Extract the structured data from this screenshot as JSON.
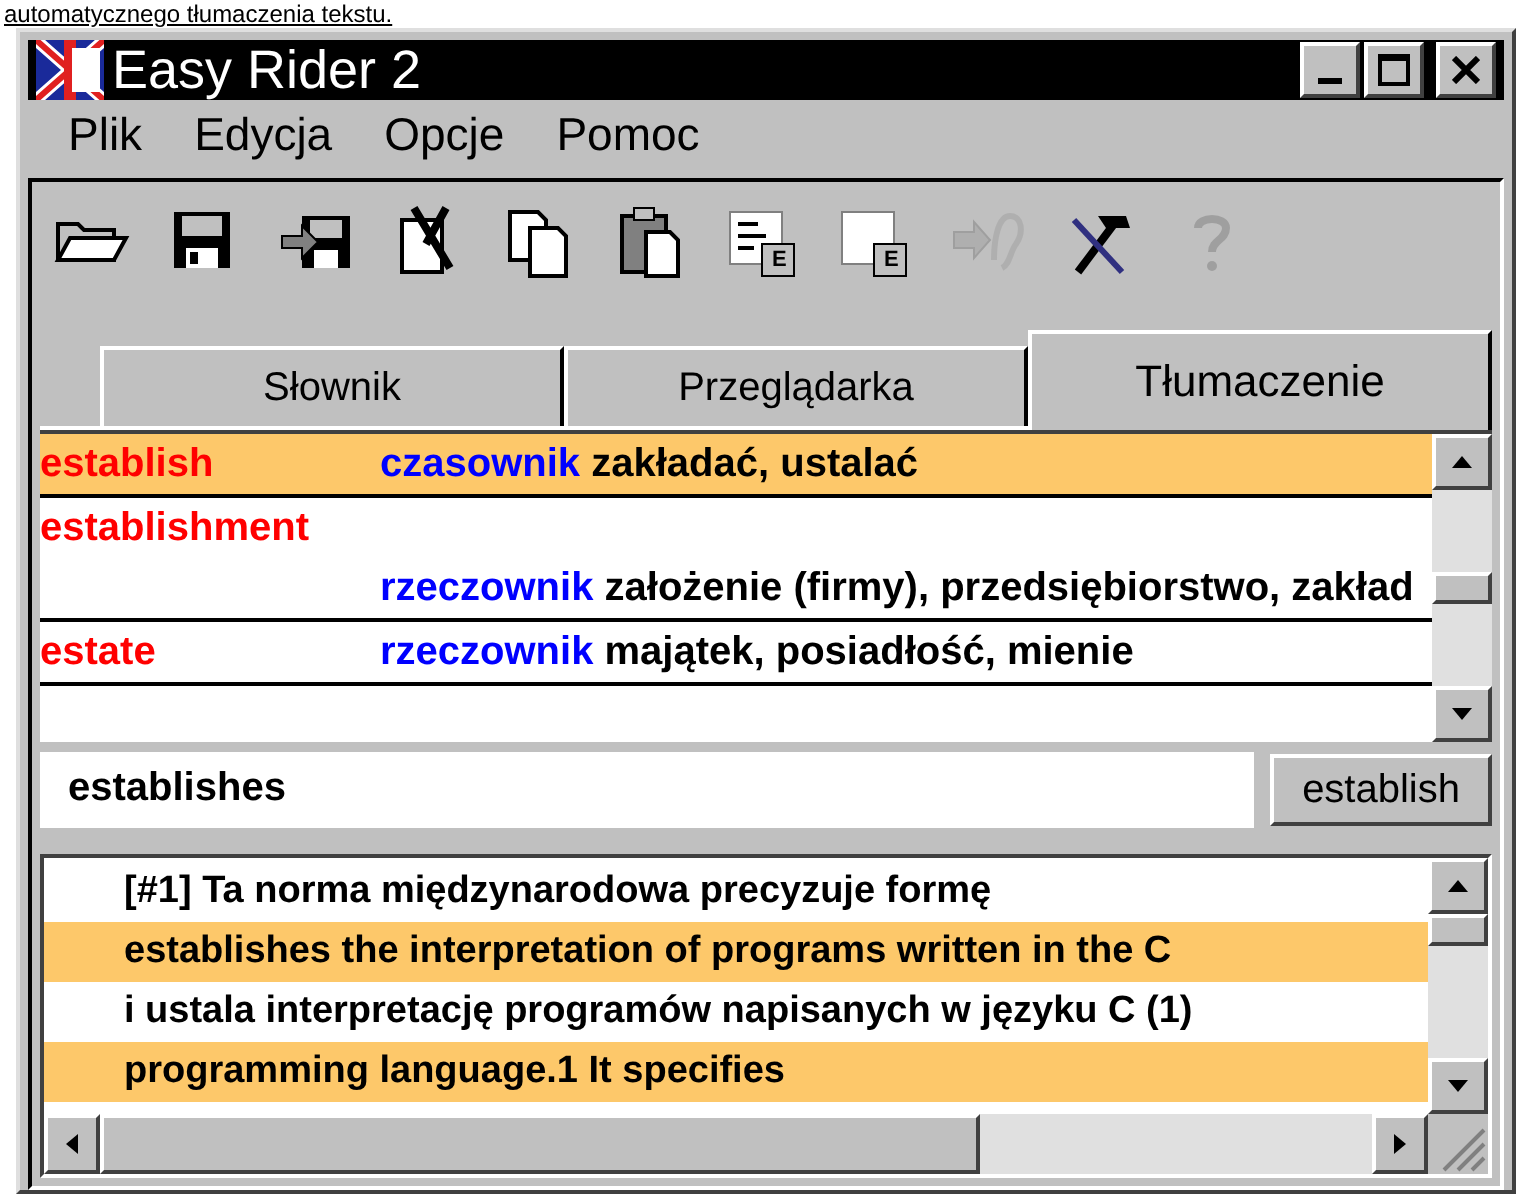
{
  "page_link": "automatycznego tłumaczenia tekstu.",
  "window": {
    "title": "Easy Rider 2",
    "controls": [
      {
        "kind": "minimize"
      },
      {
        "kind": "maximize"
      },
      {
        "kind": "close"
      }
    ]
  },
  "menu": [
    {
      "label": "Plik"
    },
    {
      "label": "Edycja"
    },
    {
      "label": "Opcje"
    },
    {
      "label": "Pomoc"
    }
  ],
  "toolbar": [
    {
      "kind": "open",
      "disabled": false
    },
    {
      "kind": "save",
      "disabled": false
    },
    {
      "kind": "export",
      "disabled": false
    },
    {
      "kind": "cut",
      "disabled": false
    },
    {
      "kind": "copy",
      "disabled": false
    },
    {
      "kind": "paste",
      "disabled": false
    },
    {
      "kind": "list",
      "disabled": false,
      "badge": "E"
    },
    {
      "kind": "page",
      "disabled": false,
      "badge": "E"
    },
    {
      "kind": "listen",
      "disabled": true
    },
    {
      "kind": "tools",
      "disabled": false
    },
    {
      "kind": "help",
      "disabled": true
    }
  ],
  "tabs": [
    {
      "label": "Słownik",
      "selected": false
    },
    {
      "label": "Przeglądarka",
      "selected": false
    },
    {
      "label": "Tłumaczenie",
      "selected": true
    }
  ],
  "dictionary": [
    {
      "headword": "establish",
      "part_of_speech": "czasownik",
      "translation": "zakładać, ustalać",
      "selected": true
    },
    {
      "headword": "establishment",
      "part_of_speech": "rzeczownik",
      "translation": "założenie (firmy), przedsiębiorstwo, zakład",
      "selected": false
    },
    {
      "headword": "estate",
      "part_of_speech": "rzeczownik",
      "translation": "majątek, posiadłość, mienie",
      "selected": false
    }
  ],
  "search": {
    "value": "establishes",
    "button": "establish"
  },
  "translation_lines": [
    {
      "text": "[#1] Ta norma międzynarodowa precyzuje formę",
      "highlighted": false
    },
    {
      "text": "establishes  the interpretation of programs written in the C",
      "highlighted": true
    },
    {
      "text": "i ustala interpretację programów napisanych w języku C (1)",
      "highlighted": false
    },
    {
      "text": "programming language.1  It specifies",
      "highlighted": true
    }
  ]
}
